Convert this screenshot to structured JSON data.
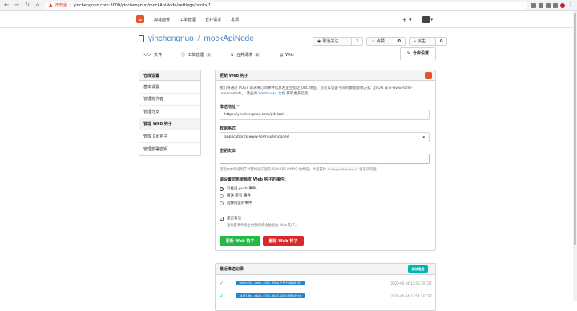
{
  "browser": {
    "insecure_label": "不安全",
    "url": "yinchengnuo.com:3000/yinchengnuo/mockApiNode/settings/hooks/1"
  },
  "header": {
    "nav": [
      "加载面板",
      "工单管理",
      "合并请求",
      "发现"
    ],
    "plus": "+ ▾"
  },
  "repo": {
    "owner": "yinchengnuo",
    "sep": "/",
    "name": "mockApiNode",
    "watch_label": "取消关注",
    "watch_count": "1",
    "star_label": "点赞",
    "star_count": "0",
    "fork_label": "派生",
    "fork_count": "0"
  },
  "tabs": {
    "code": "文件",
    "issues": "工单管理",
    "issues_count": "0",
    "pulls": "合并请求",
    "pulls_count": "0",
    "wiki": "Wiki",
    "settings": "仓库设置"
  },
  "sidebar": {
    "title": "仓库设置",
    "items": [
      "基本设置",
      "管理协作者",
      "管理分支",
      "管理 Web 钩子",
      "管理 Git 钩子",
      "管理部署密钥"
    ]
  },
  "form": {
    "title": "更新 Web 钩子",
    "desc_prefix": "我们将通过 POST 请求将订阅事件信息发送至指定 URL 地址。您可以设置不同的数据接收方式（JSON 或 x-www-form-urlencoded）。 请查阅 ",
    "desc_link": "Webhooks 文档",
    "desc_suffix": " 获取更多信息。",
    "url_label": "推送地址",
    "url_required": "*",
    "url_value": "https://yinchengnuo.com/gitHook",
    "content_type_label": "数据格式",
    "content_type_value": "application/x-www-form-urlencoded",
    "secret_label": "密钥文本",
    "secret_value": "",
    "secret_help_prefix": "密钥文本将被用于计算推送内容的 SHA256 HMAC 哈希值，并设置为 ",
    "secret_help_code": "X-Gogs-Signature",
    "secret_help_suffix": " 请求头的值。",
    "events_label": "请设置您希望触发 Web 钩子的事件：",
    "events": [
      "只推送 push 事件。",
      "推送 所有 事件",
      "选择指定的事件"
    ],
    "active_label": "是否激活",
    "active_help": "当指定事件发生时我们将会触发此 Web 钩子。",
    "update_button": "更新 Web 钩子",
    "delete_button": "删除 Web 钩子"
  },
  "recent": {
    "title": "最近推送记录",
    "test_button": "测试推送",
    "deliveries": [
      {
        "uuid": "3eb2c22e-2a6b-4012-93dd-ffff6d8b8f83",
        "time": "2020-05-24 13:56:19 CST"
      },
      {
        "uuid": "1d3f19b4-ab2b-4534-a035-427cd69b39c6",
        "time": "2020-05-24 13:54:24 CST"
      }
    ]
  }
}
